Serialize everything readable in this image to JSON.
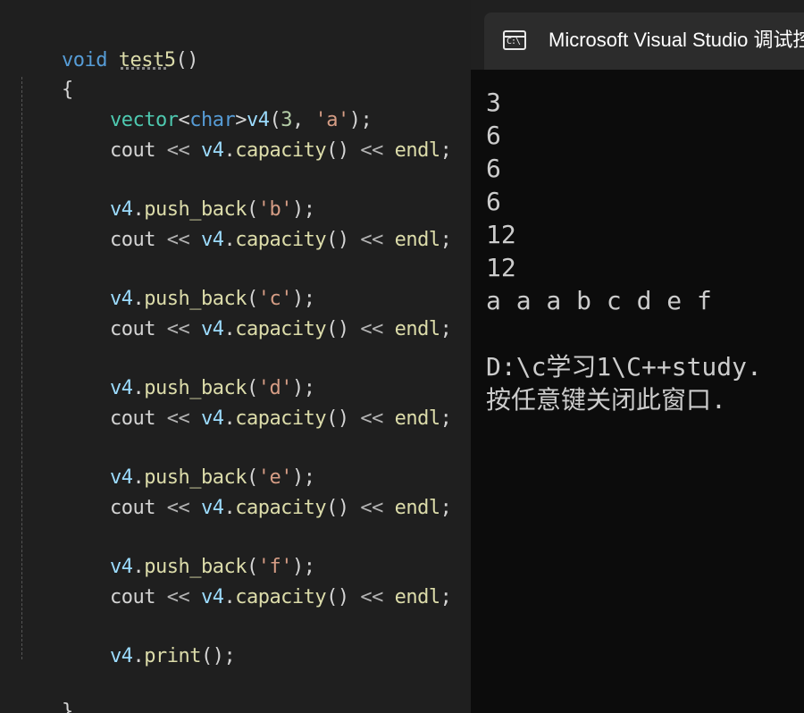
{
  "editor": {
    "lines": [
      {
        "t": "void test5()"
      },
      {
        "t": "{"
      },
      {
        "t": "vector<char>v4(3, 'a');"
      },
      {
        "t": "cout << v4.capacity() << endl;"
      },
      {
        "t": "v4.push_back('b');"
      },
      {
        "t": "cout << v4.capacity() << endl;"
      },
      {
        "t": "v4.push_back('c');"
      },
      {
        "t": "cout << v4.capacity() << endl;"
      },
      {
        "t": "v4.push_back('d');"
      },
      {
        "t": "cout << v4.capacity() << endl;"
      },
      {
        "t": "v4.push_back('e');"
      },
      {
        "t": "cout << v4.capacity() << endl;"
      },
      {
        "t": "v4.push_back('f');"
      },
      {
        "t": "cout << v4.capacity() << endl;"
      },
      {
        "t": "v4.print();"
      },
      {
        "t": "}"
      }
    ],
    "tokens": {
      "void": "void",
      "func_name": "test5",
      "parens": "()",
      "open_brace": "{",
      "close_brace": "}",
      "vector": "vector",
      "lt": "<",
      "char": "char",
      "gt": ">",
      "v4": "v4",
      "ctor_open": "(",
      "three": "3",
      "comma": ", ",
      "char_a": "'a'",
      "ctor_close": ");",
      "cout": "cout",
      "shl": " << ",
      "dot": ".",
      "capacity": "capacity",
      "call_parens": "()",
      "endl": "endl",
      "semicolon": ";",
      "push_back": "push_back",
      "open_paren": "(",
      "close_stmt": ");",
      "char_b": "'b'",
      "char_c": "'c'",
      "char_d": "'d'",
      "char_e": "'e'",
      "char_f": "'f'",
      "print": "print"
    }
  },
  "console": {
    "title": "Microsoft Visual Studio 调试控制台",
    "icon": "console-icon",
    "icon_text": "C:\\",
    "output": [
      "3",
      "6",
      "6",
      "6",
      "12",
      "12",
      "a a a b c d e f",
      "",
      "D:\\c学习1\\C++study.",
      "按任意键关闭此窗口."
    ]
  },
  "colors": {
    "editor_bg": "#1f1f1f",
    "keyword": "#569cd6",
    "function": "#dcdcaa",
    "type": "#4ec9b0",
    "variable": "#9cdcfe",
    "string": "#d69d85",
    "number": "#b5cea8",
    "console_bg": "#0c0c0c",
    "console_text": "#cccccc"
  }
}
